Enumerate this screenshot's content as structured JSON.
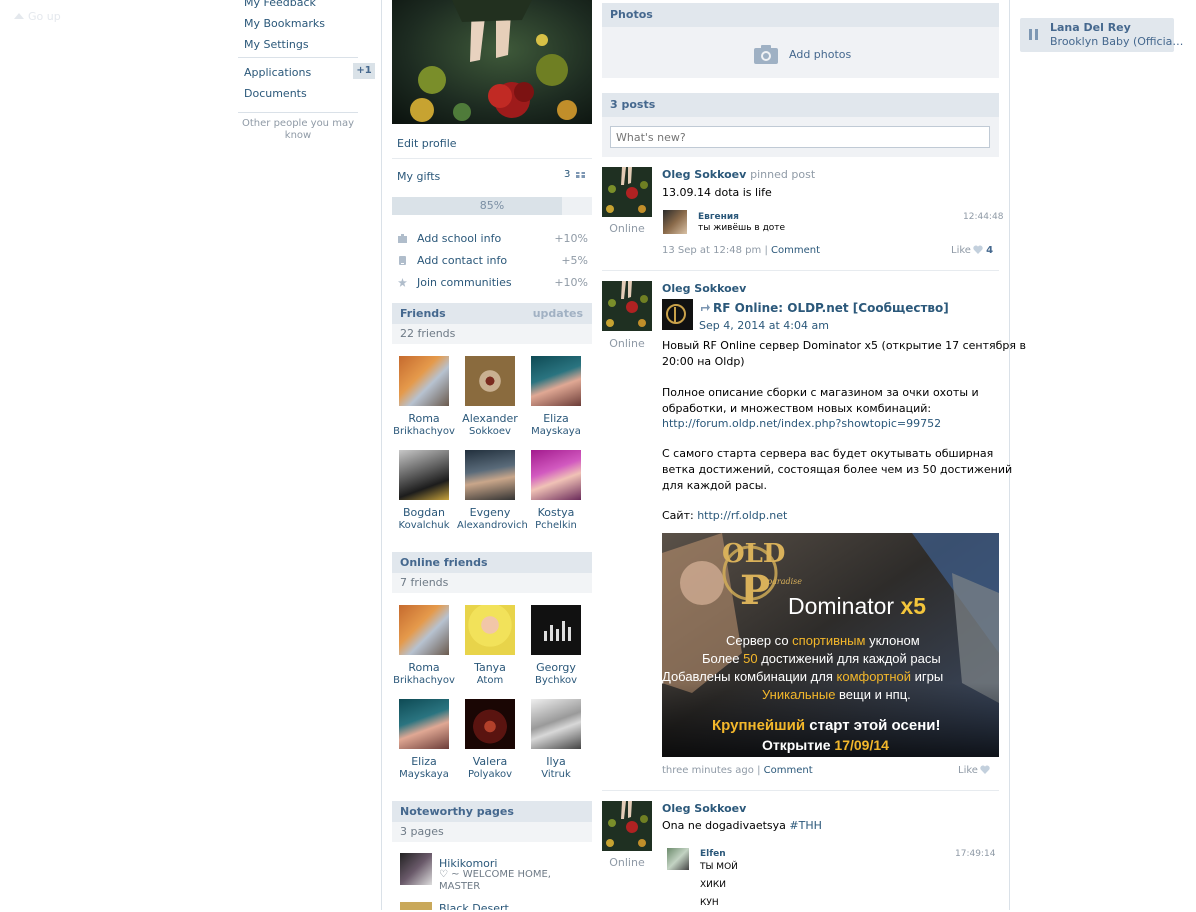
{
  "left_nav": {
    "go_up": "Go up",
    "items": [
      "My Feedback",
      "My Bookmarks",
      "My Settings",
      "Applications",
      "Documents"
    ],
    "applications_badge": "+1",
    "other_people": "Other people you may know"
  },
  "profile": {
    "edit_profile": "Edit profile",
    "my_gifts": "My gifts",
    "gifts_count": "3",
    "completion": {
      "percent": 85,
      "label": "85%"
    },
    "tasks": [
      {
        "label": "Add school info",
        "pct": "+10%",
        "icon": "school-icon"
      },
      {
        "label": "Add contact info",
        "pct": "+5%",
        "icon": "phone-icon"
      },
      {
        "label": "Join communities",
        "pct": "+10%",
        "icon": "star-icon"
      }
    ]
  },
  "friends": {
    "title": "Friends",
    "updates": "updates",
    "count": "22 friends",
    "list": [
      {
        "first": "Roma",
        "last": "Brikhachyov"
      },
      {
        "first": "Alexander",
        "last": "Sokkoev"
      },
      {
        "first": "Eliza",
        "last": "Mayskaya"
      },
      {
        "first": "Bogdan",
        "last": "Kovalchuk"
      },
      {
        "first": "Evgeny",
        "last": "Alexandrovich"
      },
      {
        "first": "Kostya",
        "last": "Pchelkin"
      }
    ]
  },
  "online_friends": {
    "title": "Online friends",
    "count": "7 friends",
    "list": [
      {
        "first": "Roma",
        "last": "Brikhachyov"
      },
      {
        "first": "Tanya",
        "last": "Atom"
      },
      {
        "first": "Georgy",
        "last": "Bychkov"
      },
      {
        "first": "Eliza",
        "last": "Mayskaya"
      },
      {
        "first": "Valera",
        "last": "Polyakov"
      },
      {
        "first": "Ilya",
        "last": "Vitruk"
      }
    ]
  },
  "noteworthy": {
    "title": "Noteworthy pages",
    "count": "3 pages",
    "pages": [
      {
        "name": "Hikikomori",
        "desc": "♡ ~ WELCOME HOME, MASTER"
      },
      {
        "name": "Black Desert",
        "desc": ""
      }
    ]
  },
  "photos": {
    "title": "Photos",
    "add": "Add photos"
  },
  "wall": {
    "title": "3 posts",
    "placeholder": "What's new?",
    "posts": [
      {
        "author": "Oleg Sokkoev",
        "pinned": "pinned post",
        "text": "13.09.14 dota is life",
        "online": "Online",
        "comment": {
          "name": "Евгения",
          "text": "ты живёшь в доте",
          "time": "12:44:48"
        },
        "date": "13 Sep at 12:48 pm",
        "sep": "|",
        "comment_link": "Comment",
        "like": "Like",
        "likes": "4"
      },
      {
        "author": "Oleg Sokkoev",
        "online": "Online",
        "repost_title": "RF Online: OLDP.net [Сообщество]",
        "repost_date": "Sep 4, 2014 at 4:04 am",
        "lines": [
          "Новый RF Online сервер Dominator x5 (открытие 17 сентября в",
          "20:00 на Oldp)",
          "Полное описание сборки с магазином за очки охоты и",
          "обработки, и множеством новых комбинаций:",
          "С самого старта сервера вас будет окутывать обширная",
          "ветка достижений, состоящая более чем из 50 достижений",
          "для каждой расы."
        ],
        "link1": "http://forum.oldp.net/index.php?showtopic=99752",
        "site_label": "Сайт:",
        "link2": "http://rf.oldp.net",
        "banner": {
          "logo_old": "OLD",
          "logo_paradise": "paradise",
          "logo_p": "P",
          "title": "Dominator",
          "title_x": "x5",
          "l1a": "Сервер со ",
          "l1b": "спортивным",
          "l1c": " уклоном",
          "l2a": "Более ",
          "l2b": "50",
          "l2c": " достижений для каждой расы",
          "l3a": "Добавлены комбинации для ",
          "l3b": "комфортной",
          "l3c": " игры",
          "l4a": "Уникальные",
          "l4b": " вещи и нпц.",
          "l5a": "Крупнейший",
          "l5b": " старт этой осени!",
          "l6a": "Открытие ",
          "l6b": "17/09/14"
        },
        "date": "three minutes ago",
        "sep": "|",
        "comment_link": "Comment",
        "like": "Like"
      },
      {
        "author": "Oleg Sokkoev",
        "online": "Online",
        "text": "Ona ne dogadivaetsya",
        "hashtag": "#THH",
        "comment": {
          "name": "Elfen",
          "lines": [
            "ТЫ МОЙ",
            "ХИКИ",
            "КУН"
          ],
          "time": "17:49:14"
        }
      }
    ]
  },
  "audio": {
    "artist": "Lana Del Rey",
    "track": "Brooklyn Baby (Officia…"
  },
  "colors": {
    "link": "#2b587a",
    "header_bg": "#e1e7ed",
    "muted": "#8f9aa6"
  }
}
